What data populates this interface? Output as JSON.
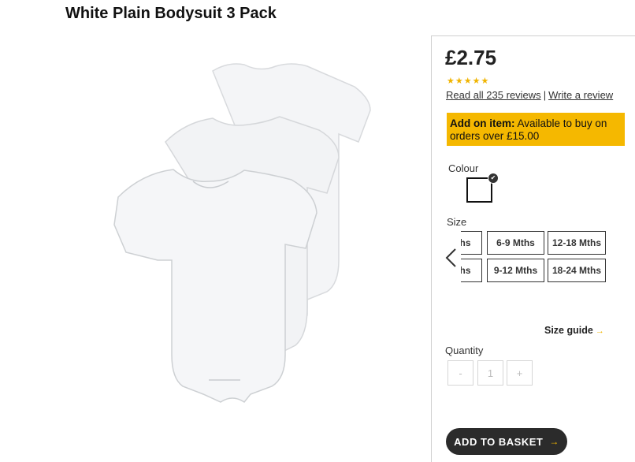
{
  "product": {
    "title": "White Plain Bodysuit 3 Pack",
    "price": "£2.75",
    "rating_stars": "★★★★★",
    "reviews_link": "Read all 235 reviews",
    "review_separator": "|",
    "write_review": "Write a review"
  },
  "addon": {
    "label": "Add on item:",
    "text": " Available to buy on orders over £15.00"
  },
  "colour": {
    "label": "Colour",
    "selected_check": "✔"
  },
  "size": {
    "label": "Size",
    "options": [
      "ths",
      "6-9 Mths",
      "12-18 Mths",
      "ths",
      "9-12 Mths",
      "18-24 Mths"
    ]
  },
  "size_guide": {
    "label": "Size guide",
    "arrow": "→"
  },
  "quantity": {
    "label": "Quantity",
    "minus": "-",
    "value": "1",
    "plus": "+"
  },
  "basket": {
    "label": "ADD TO BASKET",
    "arrow": "→"
  },
  "colors": {
    "accent_yellow": "#f5b800",
    "basket_bg": "#2b2b2b"
  }
}
